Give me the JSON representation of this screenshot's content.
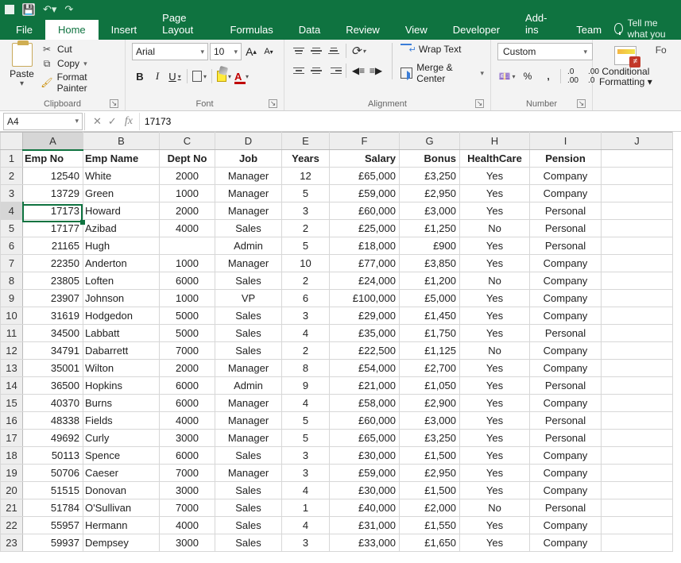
{
  "titlebar": {},
  "tabs": {
    "file": "File",
    "home": "Home",
    "insert": "Insert",
    "page_layout": "Page Layout",
    "formulas": "Formulas",
    "data": "Data",
    "review": "Review",
    "view": "View",
    "developer": "Developer",
    "addins": "Add-ins",
    "team": "Team",
    "tellme": "Tell me what you"
  },
  "ribbon": {
    "clipboard": {
      "label": "Clipboard",
      "paste": "Paste",
      "cut": "Cut",
      "copy": "Copy",
      "format_painter": "Format Painter"
    },
    "font": {
      "label": "Font",
      "name": "Arial",
      "size": "10",
      "increase": "A",
      "decrease": "A"
    },
    "alignment": {
      "label": "Alignment",
      "wrap": "Wrap Text",
      "merge": "Merge & Center"
    },
    "number": {
      "label": "Number",
      "format": "Custom"
    },
    "styles": {
      "conditional": "Conditional",
      "formatting": "Formatting",
      "format_as": "Fo"
    }
  },
  "fbar": {
    "name": "A4",
    "formula": "17173"
  },
  "columns": [
    "A",
    "B",
    "C",
    "D",
    "E",
    "F",
    "G",
    "H",
    "I",
    "J"
  ],
  "headers": {
    "emp_no": "Emp No",
    "emp_name": "Emp Name",
    "dept_no": "Dept No",
    "job": "Job",
    "years": "Years",
    "salary": "Salary",
    "bonus": "Bonus",
    "healthcare": "HealthCare",
    "pension": "Pension"
  },
  "rows": [
    {
      "n": "2",
      "emp_no": "12540",
      "name": "White",
      "dept": "2000",
      "job": "Manager",
      "yrs": "12",
      "sal": "£65,000",
      "bon": "£3,250",
      "hc": "Yes",
      "pen": "Company"
    },
    {
      "n": "3",
      "emp_no": "13729",
      "name": "Green",
      "dept": "1000",
      "job": "Manager",
      "yrs": "5",
      "sal": "£59,000",
      "bon": "£2,950",
      "hc": "Yes",
      "pen": "Company"
    },
    {
      "n": "4",
      "emp_no": "17173",
      "name": "Howard",
      "dept": "2000",
      "job": "Manager",
      "yrs": "3",
      "sal": "£60,000",
      "bon": "£3,000",
      "hc": "Yes",
      "pen": "Personal"
    },
    {
      "n": "5",
      "emp_no": "17177",
      "name": "Azibad",
      "dept": "4000",
      "job": "Sales",
      "yrs": "2",
      "sal": "£25,000",
      "bon": "£1,250",
      "hc": "No",
      "pen": "Personal"
    },
    {
      "n": "6",
      "emp_no": "21165",
      "name": "Hugh",
      "dept": "",
      "job": "Admin",
      "yrs": "5",
      "sal": "£18,000",
      "bon": "£900",
      "hc": "Yes",
      "pen": "Personal"
    },
    {
      "n": "7",
      "emp_no": "22350",
      "name": "Anderton",
      "dept": "1000",
      "job": "Manager",
      "yrs": "10",
      "sal": "£77,000",
      "bon": "£3,850",
      "hc": "Yes",
      "pen": "Company"
    },
    {
      "n": "8",
      "emp_no": "23805",
      "name": "Loften",
      "dept": "6000",
      "job": "Sales",
      "yrs": "2",
      "sal": "£24,000",
      "bon": "£1,200",
      "hc": "No",
      "pen": "Company"
    },
    {
      "n": "9",
      "emp_no": "23907",
      "name": "Johnson",
      "dept": "1000",
      "job": "VP",
      "yrs": "6",
      "sal": "£100,000",
      "bon": "£5,000",
      "hc": "Yes",
      "pen": "Company"
    },
    {
      "n": "10",
      "emp_no": "31619",
      "name": "Hodgedon",
      "dept": "5000",
      "job": "Sales",
      "yrs": "3",
      "sal": "£29,000",
      "bon": "£1,450",
      "hc": "Yes",
      "pen": "Company"
    },
    {
      "n": "11",
      "emp_no": "34500",
      "name": "Labbatt",
      "dept": "5000",
      "job": "Sales",
      "yrs": "4",
      "sal": "£35,000",
      "bon": "£1,750",
      "hc": "Yes",
      "pen": "Personal"
    },
    {
      "n": "12",
      "emp_no": "34791",
      "name": "Dabarrett",
      "dept": "7000",
      "job": "Sales",
      "yrs": "2",
      "sal": "£22,500",
      "bon": "£1,125",
      "hc": "No",
      "pen": "Company"
    },
    {
      "n": "13",
      "emp_no": "35001",
      "name": "Wilton",
      "dept": "2000",
      "job": "Manager",
      "yrs": "8",
      "sal": "£54,000",
      "bon": "£2,700",
      "hc": "Yes",
      "pen": "Company"
    },
    {
      "n": "14",
      "emp_no": "36500",
      "name": "Hopkins",
      "dept": "6000",
      "job": "Admin",
      "yrs": "9",
      "sal": "£21,000",
      "bon": "£1,050",
      "hc": "Yes",
      "pen": "Personal"
    },
    {
      "n": "15",
      "emp_no": "40370",
      "name": "Burns",
      "dept": "6000",
      "job": "Manager",
      "yrs": "4",
      "sal": "£58,000",
      "bon": "£2,900",
      "hc": "Yes",
      "pen": "Company"
    },
    {
      "n": "16",
      "emp_no": "48338",
      "name": "Fields",
      "dept": "4000",
      "job": "Manager",
      "yrs": "5",
      "sal": "£60,000",
      "bon": "£3,000",
      "hc": "Yes",
      "pen": "Personal"
    },
    {
      "n": "17",
      "emp_no": "49692",
      "name": "Curly",
      "dept": "3000",
      "job": "Manager",
      "yrs": "5",
      "sal": "£65,000",
      "bon": "£3,250",
      "hc": "Yes",
      "pen": "Personal"
    },
    {
      "n": "18",
      "emp_no": "50113",
      "name": "Spence",
      "dept": "6000",
      "job": "Sales",
      "yrs": "3",
      "sal": "£30,000",
      "bon": "£1,500",
      "hc": "Yes",
      "pen": "Company"
    },
    {
      "n": "19",
      "emp_no": "50706",
      "name": "Caeser",
      "dept": "7000",
      "job": "Manager",
      "yrs": "3",
      "sal": "£59,000",
      "bon": "£2,950",
      "hc": "Yes",
      "pen": "Company"
    },
    {
      "n": "20",
      "emp_no": "51515",
      "name": "Donovan",
      "dept": "3000",
      "job": "Sales",
      "yrs": "4",
      "sal": "£30,000",
      "bon": "£1,500",
      "hc": "Yes",
      "pen": "Company"
    },
    {
      "n": "21",
      "emp_no": "51784",
      "name": "O'Sullivan",
      "dept": "7000",
      "job": "Sales",
      "yrs": "1",
      "sal": "£40,000",
      "bon": "£2,000",
      "hc": "No",
      "pen": "Personal"
    },
    {
      "n": "22",
      "emp_no": "55957",
      "name": "Hermann",
      "dept": "4000",
      "job": "Sales",
      "yrs": "4",
      "sal": "£31,000",
      "bon": "£1,550",
      "hc": "Yes",
      "pen": "Company"
    },
    {
      "n": "23",
      "emp_no": "59937",
      "name": "Dempsey",
      "dept": "3000",
      "job": "Sales",
      "yrs": "3",
      "sal": "£33,000",
      "bon": "£1,650",
      "hc": "Yes",
      "pen": "Company"
    }
  ],
  "selection": {
    "row_index": 2,
    "col": "A"
  }
}
